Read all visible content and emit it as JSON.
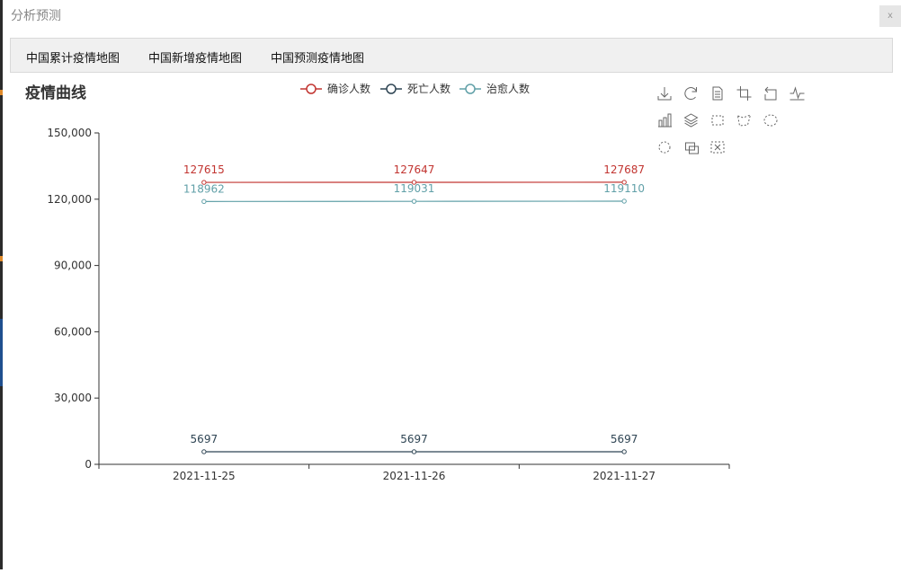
{
  "dialog": {
    "title": "分析预测",
    "close_label": "x"
  },
  "tabs": [
    {
      "label": "中国累计疫情地图"
    },
    {
      "label": "中国新增疫情地图"
    },
    {
      "label": "中国预测疫情地图"
    }
  ],
  "toolbox": {
    "icons": [
      "download-icon",
      "refresh-icon",
      "data-view-icon",
      "crop-icon",
      "undo-icon",
      "line-chart-icon",
      "bar-chart-icon",
      "stack-icon",
      "rect-select-icon",
      "polygon-select-icon",
      "lasso-icon",
      "keep-select-icon",
      "clear-select-icon",
      "zoom-reset-icon"
    ]
  },
  "chart_data": {
    "type": "line",
    "title": "疫情曲线",
    "categories": [
      "2021-11-25",
      "2021-11-26",
      "2021-11-27"
    ],
    "series": [
      {
        "name": "确诊人数",
        "values": [
          127615,
          127647,
          127687
        ],
        "color": "#c23531"
      },
      {
        "name": "死亡人数",
        "values": [
          5697,
          5697,
          5697
        ],
        "color": "#2f4554"
      },
      {
        "name": "治愈人数",
        "values": [
          118962,
          119031,
          119110
        ],
        "color": "#61a0a8"
      }
    ],
    "ylim": [
      0,
      150000
    ],
    "yticks": [
      "0",
      "30,000",
      "60,000",
      "90,000",
      "120,000",
      "150,000"
    ],
    "ytick_values": [
      0,
      30000,
      60000,
      90000,
      120000,
      150000
    ],
    "legend_position": "top-center",
    "grid": false
  }
}
